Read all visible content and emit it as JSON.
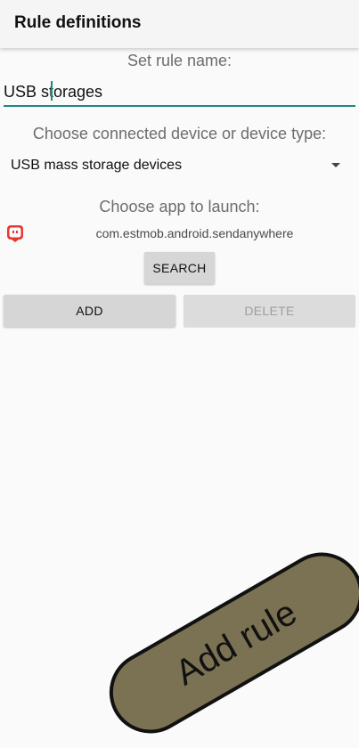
{
  "appbar": {
    "title": "Rule definitions"
  },
  "rule_name": {
    "label": "Set rule name:",
    "value": "USB storages"
  },
  "device": {
    "label": "Choose connected device or device type:",
    "selected": "USB mass storage devices"
  },
  "app": {
    "label": "Choose app to launch:",
    "package": "com.estmob.android.sendanywhere",
    "icon": "send-anywhere-app-icon",
    "icon_color": "#e53935"
  },
  "buttons": {
    "search": "SEARCH",
    "add": "ADD",
    "delete": "DELETE"
  },
  "fab": {
    "label": "Add rule",
    "color": "#7b7153"
  },
  "colors": {
    "accent": "#1a8a80",
    "background": "#fafafa"
  }
}
